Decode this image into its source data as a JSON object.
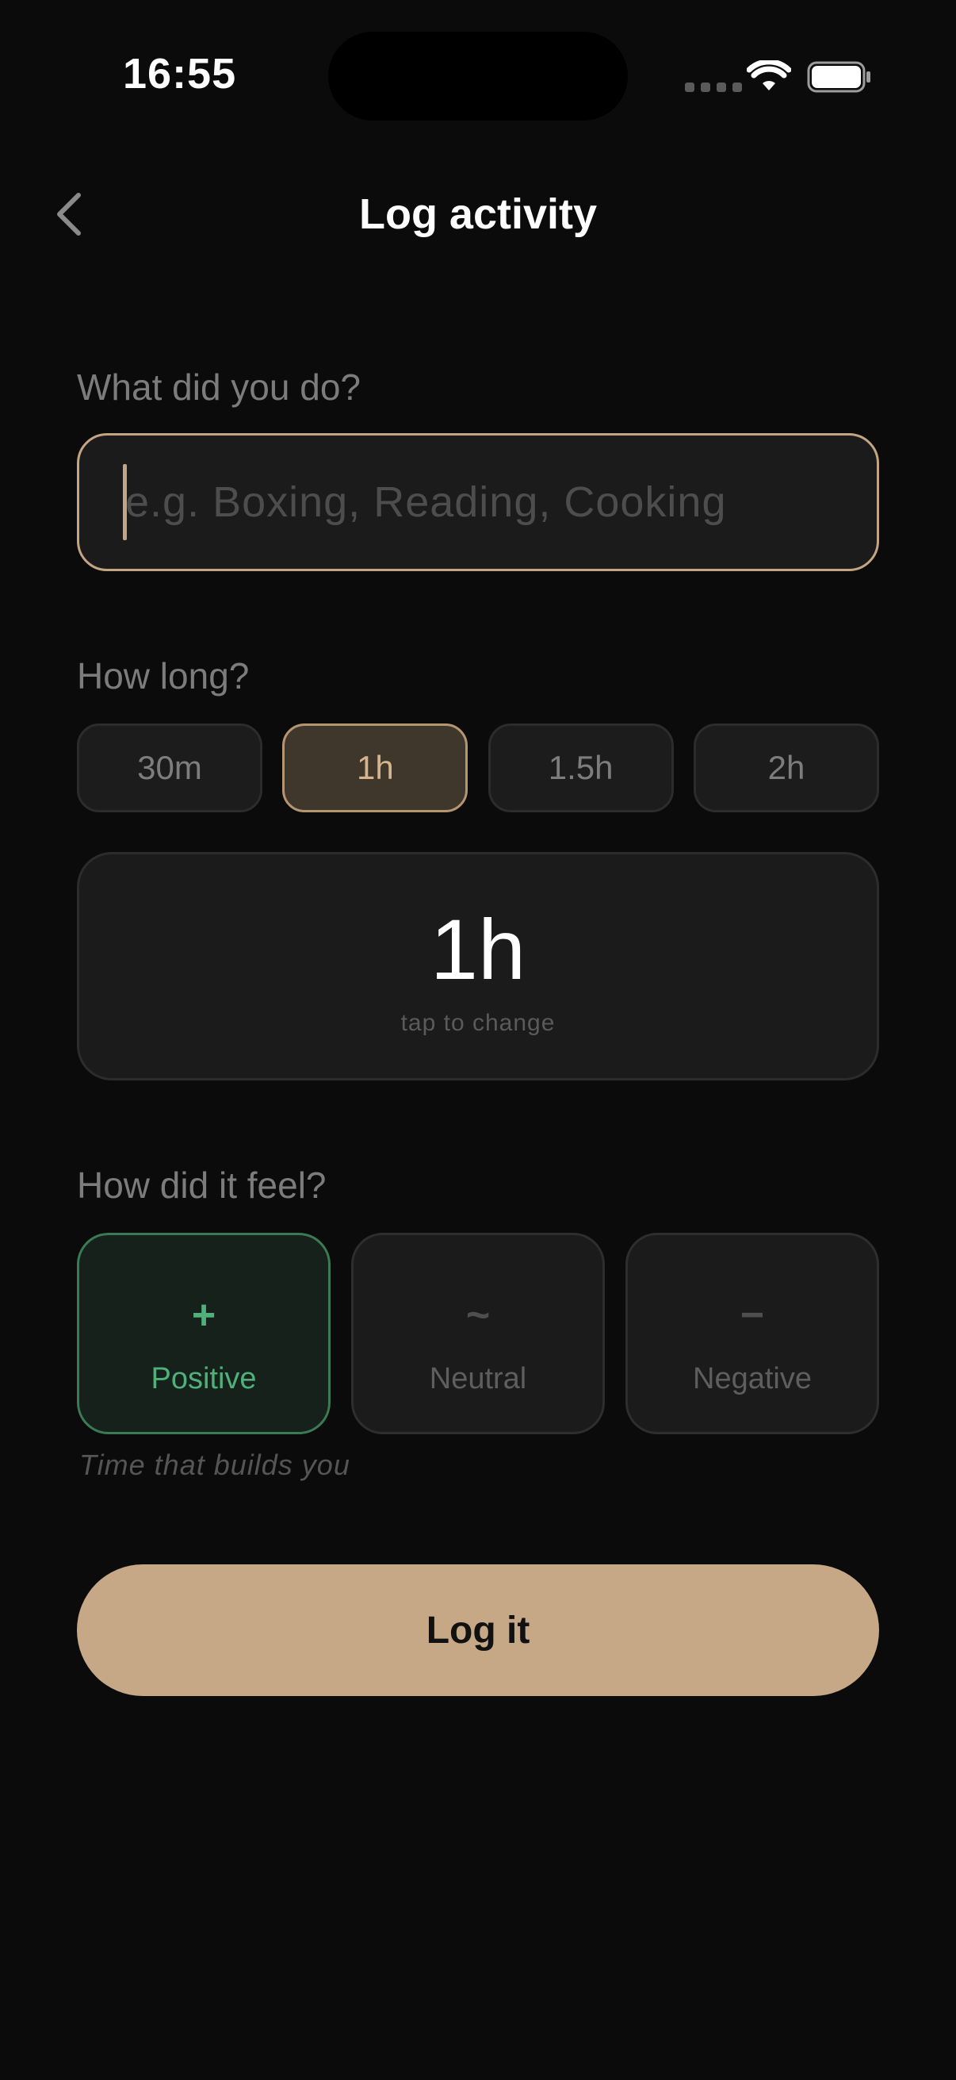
{
  "status_bar": {
    "time": "16:55"
  },
  "header": {
    "title": "Log activity",
    "back_icon": "chevron-left-icon"
  },
  "activity": {
    "label": "What did you do?",
    "placeholder": "e.g. Boxing, Reading, Cooking",
    "value": ""
  },
  "duration": {
    "label": "How long?",
    "options": [
      "30m",
      "1h",
      "1.5h",
      "2h"
    ],
    "selected": "1h",
    "display_value": "1h",
    "hint": "tap to change"
  },
  "feeling": {
    "label": "How did it feel?",
    "options": [
      {
        "symbol": "+",
        "label": "Positive",
        "selected": true
      },
      {
        "symbol": "~",
        "label": "Neutral",
        "selected": false
      },
      {
        "symbol": "−",
        "label": "Negative",
        "selected": false
      }
    ],
    "caption": "Time that builds you"
  },
  "submit": {
    "label": "Log it"
  },
  "colors": {
    "background": "#0b0b0b",
    "accent": "#c6a886",
    "positive": "#4fb07a",
    "card": "#1b1b1b"
  }
}
